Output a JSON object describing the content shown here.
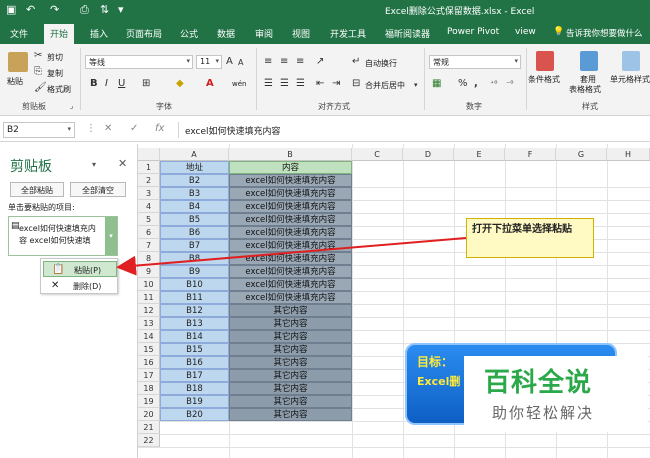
{
  "window": {
    "title": "Excel删除公式保留数据.xlsx - Excel"
  },
  "tabs": [
    "文件",
    "开始",
    "插入",
    "页面布局",
    "公式",
    "数据",
    "审阅",
    "视图",
    "开发工具",
    "福昕阅读器",
    "Power Pivot",
    "view"
  ],
  "active_tab": "开始",
  "tell_me": "告诉我你想要做什么",
  "ribbon": {
    "clipboard": {
      "paste": "粘贴",
      "cut": "剪切",
      "copy": "复制",
      "format_painter": "格式刷",
      "group": "剪贴板"
    },
    "font": {
      "name": "等线",
      "size": "11",
      "group": "字体",
      "bold": "B",
      "italic": "I",
      "underline": "U",
      "wen": "wén"
    },
    "alignment": {
      "wrap": "自动换行",
      "merge": "合并后居中",
      "group": "对齐方式"
    },
    "number": {
      "format": "常规",
      "percent": "%",
      "comma": ",",
      "group": "数字"
    },
    "styles": {
      "conditional": "条件格式",
      "table": "套用",
      "table2": "表格格式",
      "cell": "单元格样式",
      "group": "样式"
    }
  },
  "formula_bar": {
    "name_box": "B2",
    "cancel": "✕",
    "enter": "✓",
    "fx": "fx",
    "content": "excel如何快速填充内容"
  },
  "clipboard_pane": {
    "title": "剪贴板",
    "paste_all": "全部粘贴",
    "clear_all": "全部清空",
    "hint": "单击要粘贴的项目:",
    "item_line1": "excel如何快速填充内",
    "item_line2": "容 excel如何快速填",
    "menu": {
      "paste": "粘贴(P)",
      "delete": "删除(D)"
    }
  },
  "grid": {
    "columns": [
      "A",
      "B",
      "C",
      "D",
      "E",
      "F",
      "G",
      "H"
    ],
    "header_row": {
      "A": "地址",
      "B": "内容"
    },
    "rows": [
      {
        "n": "2",
        "A": "B2",
        "B": "excel如何快速填充内容"
      },
      {
        "n": "3",
        "A": "B3",
        "B": "excel如何快速填充内容"
      },
      {
        "n": "4",
        "A": "B4",
        "B": "excel如何快速填充内容"
      },
      {
        "n": "5",
        "A": "B5",
        "B": "excel如何快速填充内容"
      },
      {
        "n": "6",
        "A": "B6",
        "B": "excel如何快速填充内容"
      },
      {
        "n": "7",
        "A": "B7",
        "B": "excel如何快速填充内容"
      },
      {
        "n": "8",
        "A": "B8",
        "B": "excel如何快速填充内容"
      },
      {
        "n": "9",
        "A": "B9",
        "B": "excel如何快速填充内容"
      },
      {
        "n": "10",
        "A": "B10",
        "B": "excel如何快速填充内容"
      },
      {
        "n": "11",
        "A": "B11",
        "B": "excel如何快速填充内容"
      },
      {
        "n": "12",
        "A": "B12",
        "B": "其它内容"
      },
      {
        "n": "13",
        "A": "B13",
        "B": "其它内容"
      },
      {
        "n": "14",
        "A": "B14",
        "B": "其它内容"
      },
      {
        "n": "15",
        "A": "B15",
        "B": "其它内容"
      },
      {
        "n": "16",
        "A": "B16",
        "B": "其它内容"
      },
      {
        "n": "17",
        "A": "B17",
        "B": "其它内容"
      },
      {
        "n": "18",
        "A": "B18",
        "B": "其它内容"
      },
      {
        "n": "19",
        "A": "B19",
        "B": "其它内容"
      },
      {
        "n": "20",
        "A": "B20",
        "B": "其它内容"
      },
      {
        "n": "21",
        "A": "",
        "B": ""
      },
      {
        "n": "22",
        "A": "",
        "B": ""
      }
    ]
  },
  "callout": "打开下拉菜单选择粘贴",
  "target": {
    "label": "目标：",
    "text": "Excel删"
  },
  "watermark": {
    "brand": "百科全说",
    "slogan": "助你轻松解决"
  },
  "colors": {
    "excel_green": "#217346",
    "arrow_red": "#e02020",
    "selection_gray": "#8d9cab",
    "column_a_blue": "#bdd7ee"
  }
}
